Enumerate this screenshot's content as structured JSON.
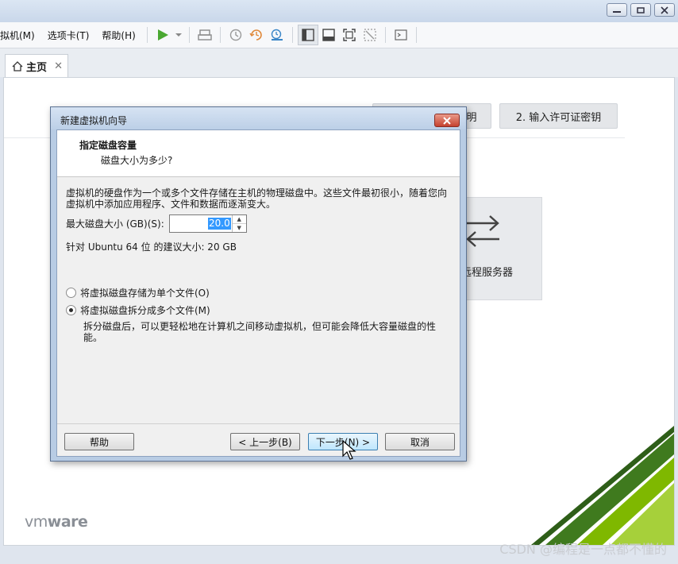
{
  "menu": {
    "items": [
      "拟机(M)",
      "选项卡(T)",
      "帮助(H)"
    ]
  },
  "tab": {
    "label": "主页",
    "close": "✕"
  },
  "home": {
    "connect_button_partial": "明",
    "license_button": "2. 输入许可证密钥",
    "remote_server_label": "远程服务器",
    "logo_light": "vm",
    "logo_bold": "ware"
  },
  "dialog": {
    "title": "新建虚拟机向导",
    "header_title": "指定磁盘容量",
    "header_subtitle": "磁盘大小为多少?",
    "description": "虚拟机的硬盘作为一个或多个文件存储在主机的物理磁盘中。这些文件最初很小，随着您向虚拟机中添加应用程序、文件和数据而逐渐变大。",
    "size_label": "最大磁盘大小 (GB)(S):",
    "size_value": "20.0",
    "recommended": "针对 Ubuntu 64 位 的建议大小: 20 GB",
    "option_single": "将虚拟磁盘存储为单个文件(O)",
    "option_split": "将虚拟磁盘拆分成多个文件(M)",
    "selected_option": "split",
    "split_description": "拆分磁盘后，可以更轻松地在计算机之间移动虚拟机，但可能会降低大容量磁盘的性能。",
    "buttons": {
      "help": "帮助",
      "back": "< 上一步(B)",
      "next": "下一步(N) >",
      "cancel": "取消"
    }
  },
  "watermark": "CSDN @编程是一点都不懂的",
  "colors": {
    "accent_green": "#7fb800",
    "dark_green": "#3f7a1e",
    "selection_blue": "#3399ff",
    "play_green": "#4aa832"
  }
}
